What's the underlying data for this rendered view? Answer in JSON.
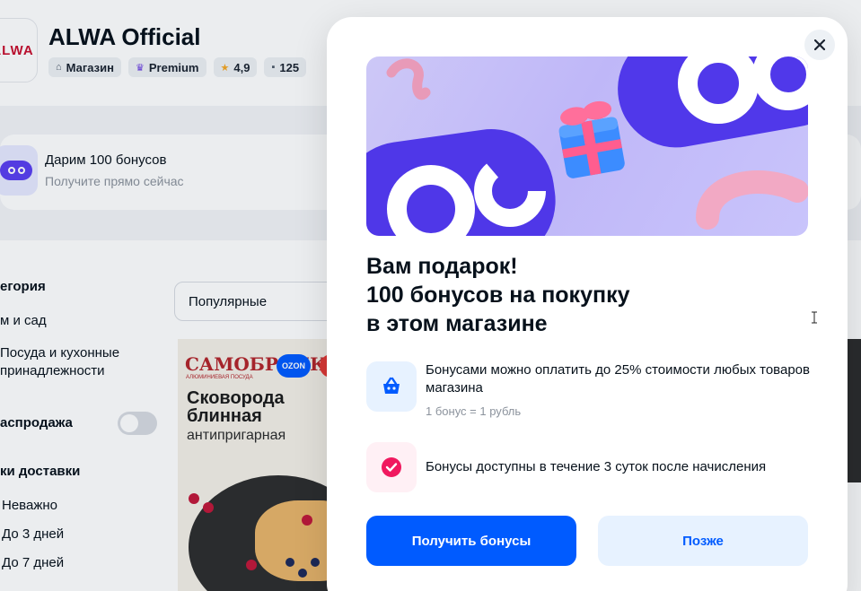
{
  "store": {
    "logo_text": "ALWA",
    "title": "ALWA Official",
    "chips": [
      {
        "icon": "shop-icon",
        "label": "Магазин"
      },
      {
        "icon": "crown-icon",
        "label": "Premium"
      },
      {
        "icon": "star-icon",
        "label": "4,9"
      },
      {
        "icon": "comment-icon",
        "label": "125"
      }
    ]
  },
  "bonus_banner": {
    "title": "Дарим 100 бонусов",
    "subtitle": "Получите прямо сейчас"
  },
  "filters": {
    "category_heading": "егория",
    "category_items": [
      "м и сад",
      "Посуда и кухонные",
      "принадлежности"
    ],
    "sale_label": "аспродажа",
    "sale_toggle_on": false,
    "delivery_heading": "ки доставки",
    "delivery_options": [
      "Неважно",
      "До 3 дней",
      "До 7 дней"
    ],
    "sort_value": "Популярные"
  },
  "product": {
    "brand": "САМОБРАНКА",
    "brand_sub": "АЛЮМИНИЕВАЯ ПОСУДА",
    "marketplace_badge": "OZON",
    "name_line1": "Сковорода",
    "name_line2": "блинная",
    "description": "антипригарная"
  },
  "modal": {
    "headline_lines": [
      "Вам подарок!",
      "100 бонусов на покупку",
      "в этом магазине"
    ],
    "info": [
      {
        "icon": "basket-icon",
        "text": "Бонусами можно оплатить до 25% стоимости любых товаров магазина",
        "note": "1 бонус = 1 рубль"
      },
      {
        "icon": "timer-check-icon",
        "text": "Бонусы доступны в течение 3 суток после начисления",
        "note": ""
      }
    ],
    "primary_button": "Получить бонусы",
    "secondary_button": "Позже"
  },
  "colors": {
    "accent": "#005bff",
    "accent_light": "#e7f2ff",
    "bonus_purple": "#5b3ff0",
    "timer_pink": "#f0195f"
  }
}
